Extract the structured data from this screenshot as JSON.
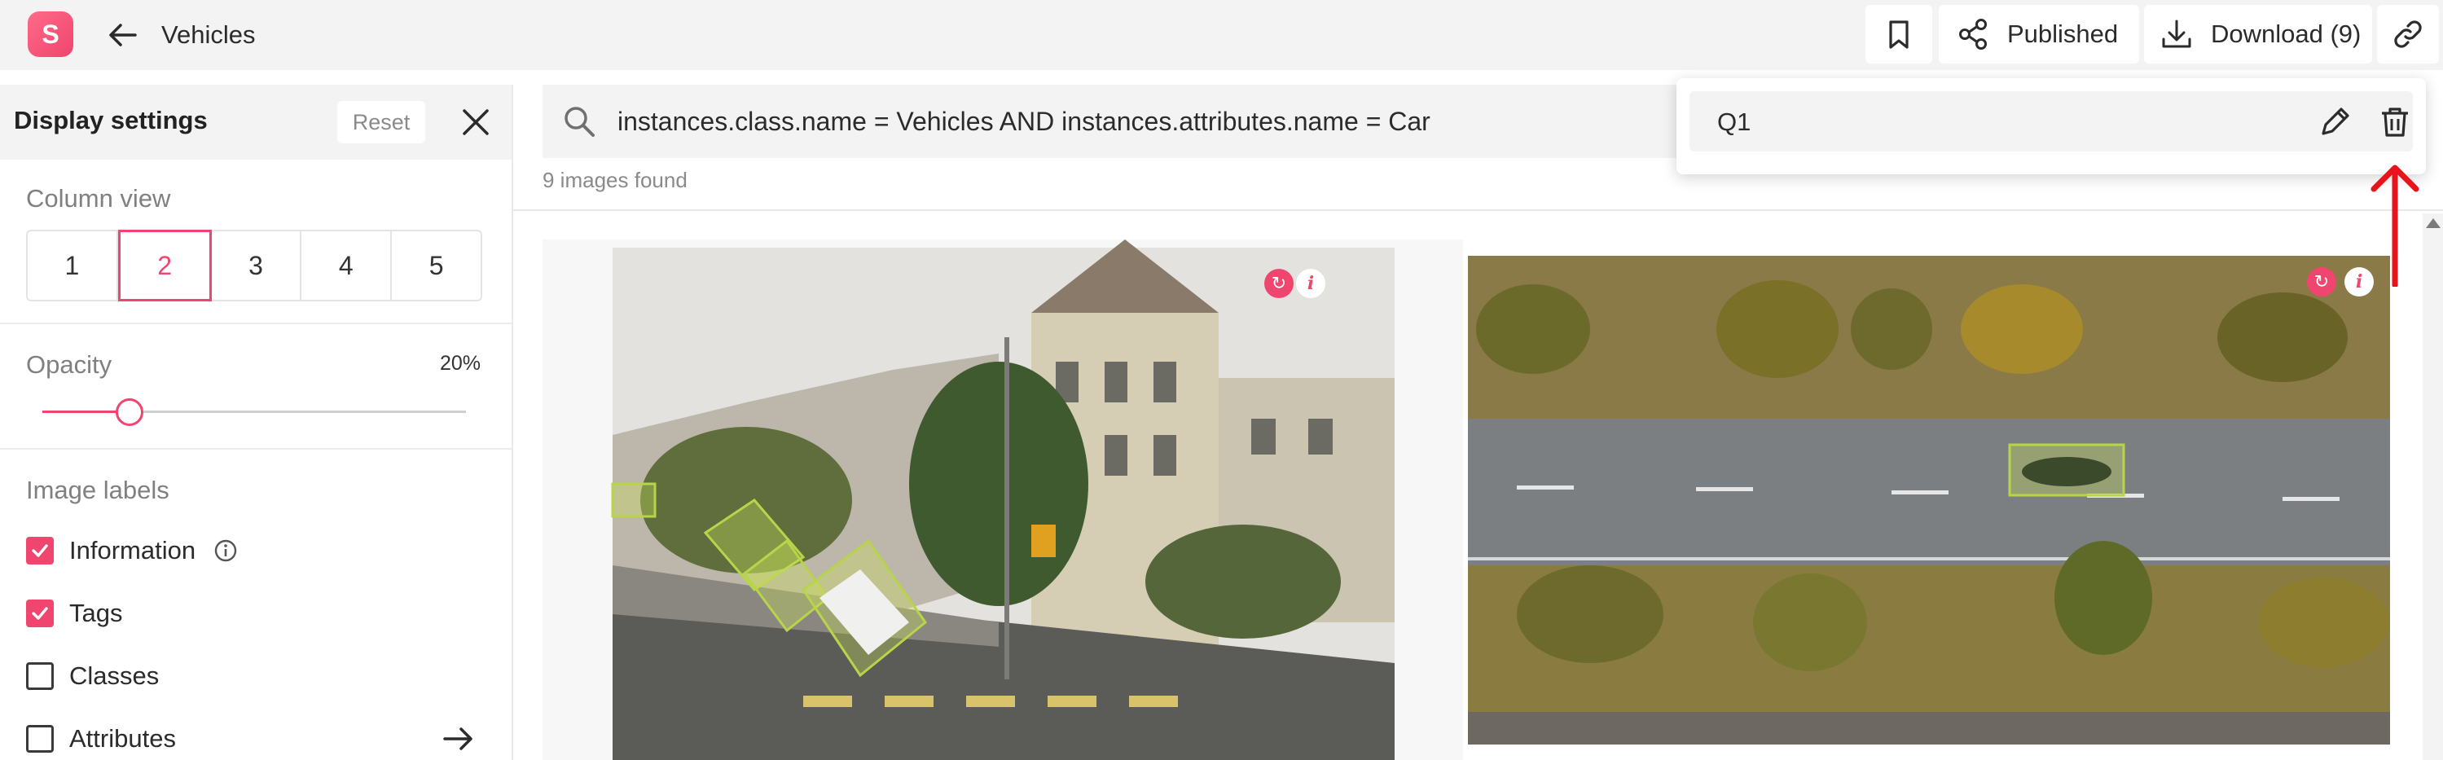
{
  "header": {
    "app_logo_letter": "S",
    "title": "Vehicles",
    "published_label": "Published",
    "download_label": "Download (9)"
  },
  "sidebar": {
    "title": "Display settings",
    "reset_label": "Reset",
    "column_view": {
      "label": "Column view",
      "options": [
        "1",
        "2",
        "3",
        "4",
        "5"
      ],
      "selected": "2"
    },
    "opacity": {
      "label": "Opacity",
      "value_text": "20%",
      "value": 0.2
    },
    "image_labels": {
      "label": "Image labels",
      "items": [
        {
          "label": "Information",
          "checked": true
        },
        {
          "label": "Tags",
          "checked": true
        },
        {
          "label": "Classes",
          "checked": false
        },
        {
          "label": "Attributes",
          "checked": false
        }
      ]
    }
  },
  "search": {
    "query": "instances.class.name = Vehicles AND instances.attributes.name = Car",
    "results_text": "9 images found"
  },
  "saved_query_popup": {
    "name": "Q1"
  },
  "colors": {
    "accent": "#f0456e",
    "annotation": "#c8e05a",
    "arrow": "#e8141b"
  }
}
